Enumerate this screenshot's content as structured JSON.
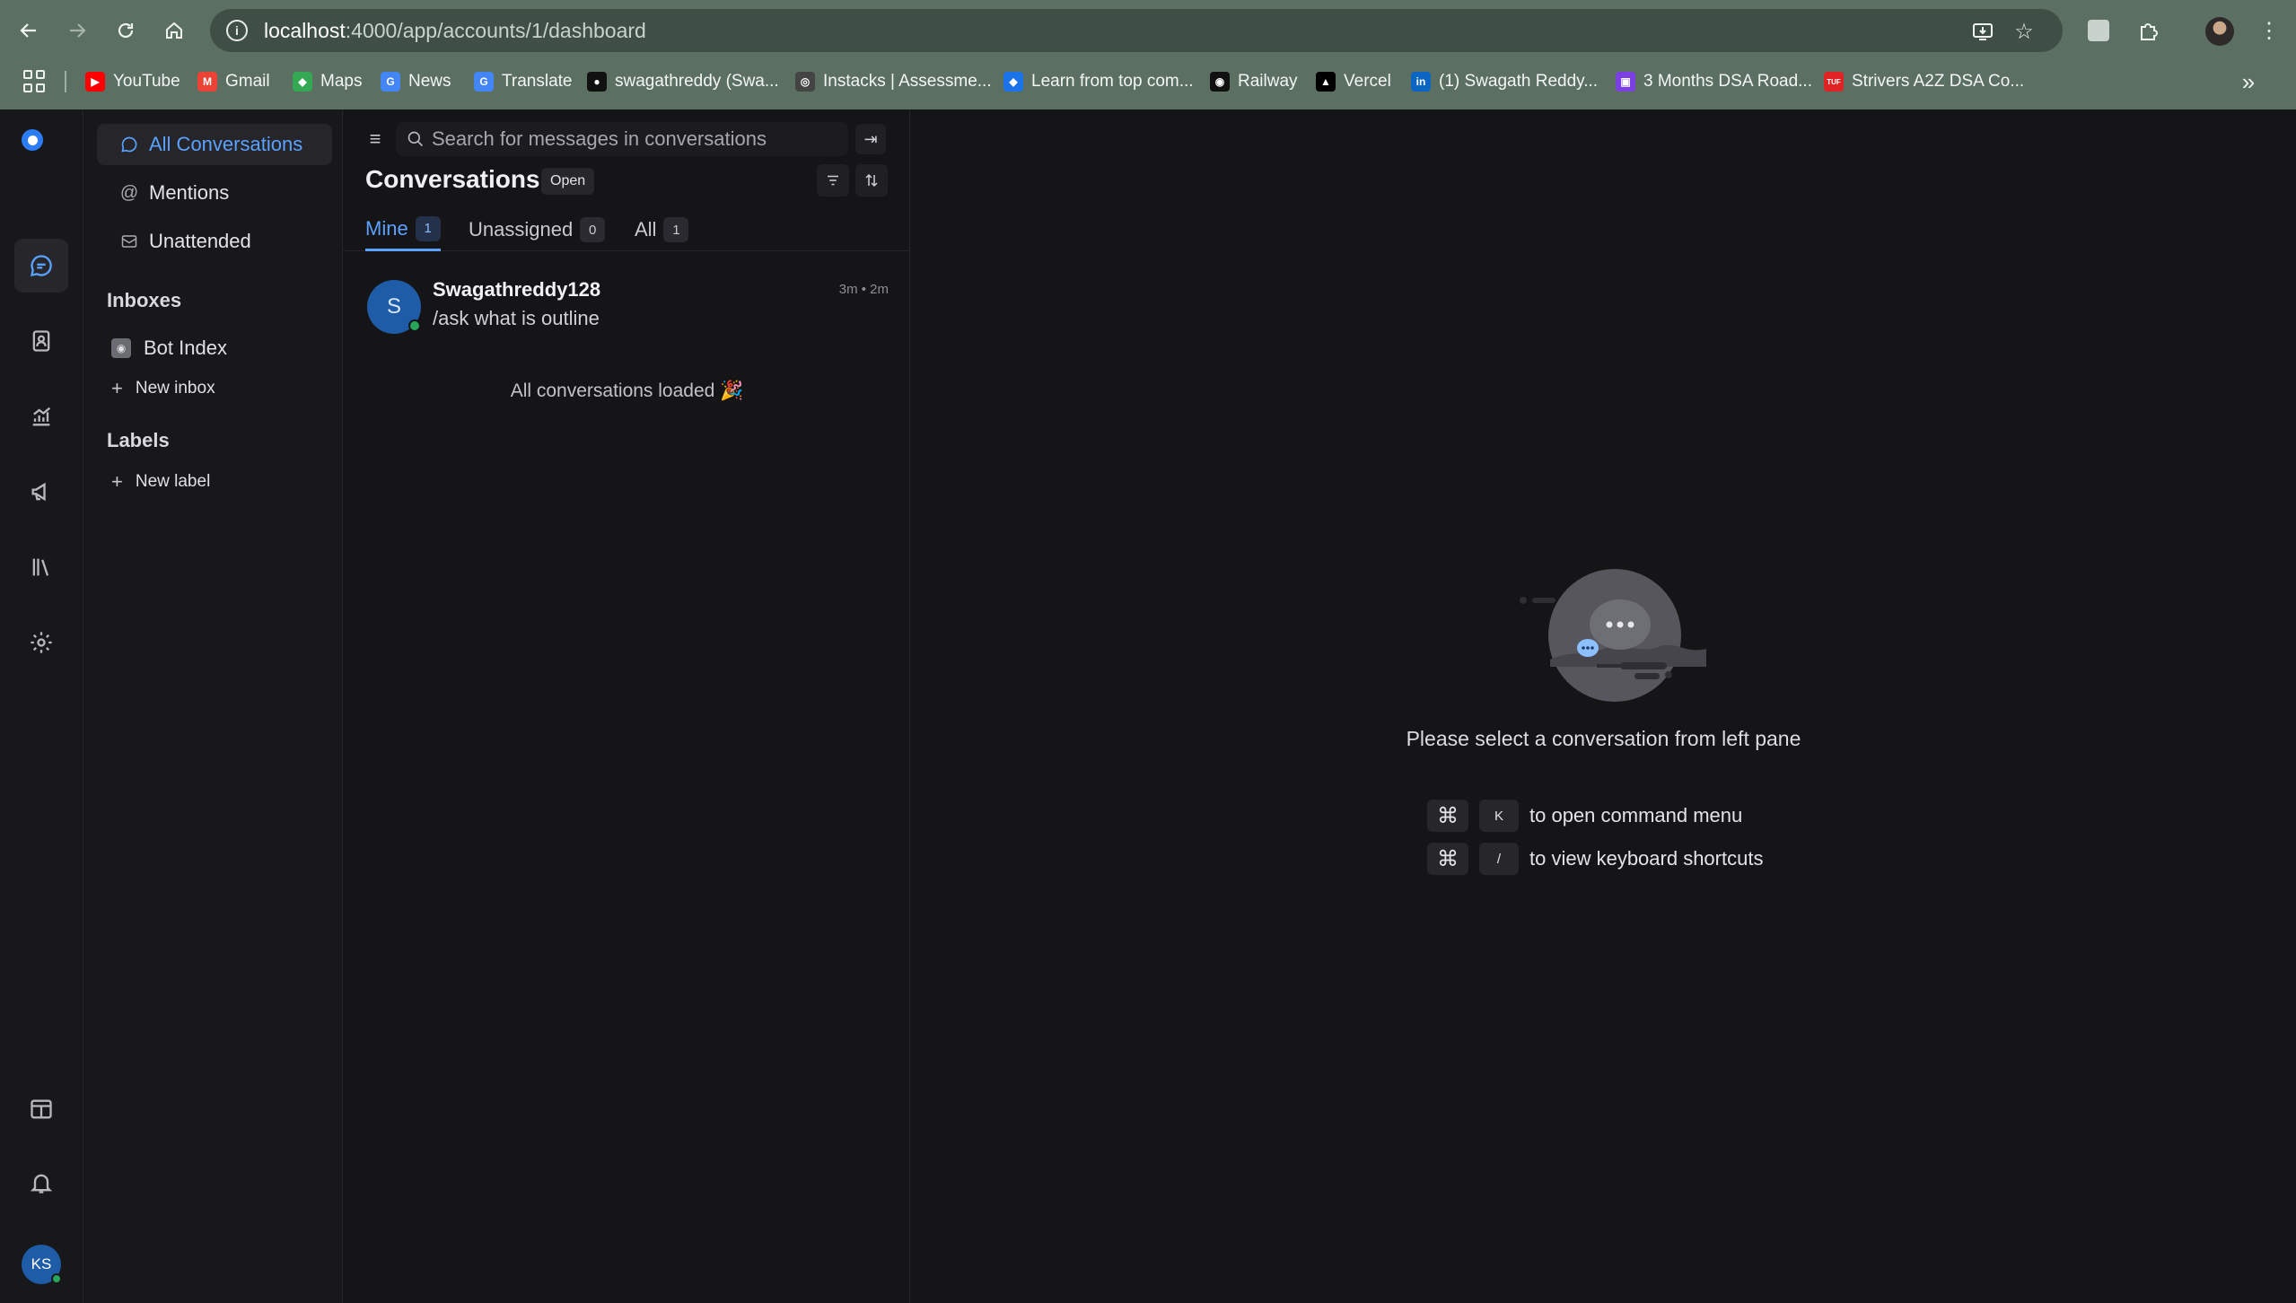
{
  "browser": {
    "url_host": "localhost",
    "url_rest": ":4000/app/accounts/1/dashboard",
    "bookmarks": [
      {
        "label": "YouTube",
        "favicon": "youtube-icon",
        "color": "#ff0000"
      },
      {
        "label": "Gmail",
        "favicon": "gmail-icon",
        "color": "#ea4335"
      },
      {
        "label": "Maps",
        "favicon": "maps-icon",
        "color": "#34a853"
      },
      {
        "label": "News",
        "favicon": "news-icon",
        "color": "#4285f4"
      },
      {
        "label": "Translate",
        "favicon": "translate-icon",
        "color": "#4285f4"
      },
      {
        "label": "swagathreddy (Swa...",
        "favicon": "github-icon",
        "color": "#111111"
      },
      {
        "label": "Instacks | Assessme...",
        "favicon": "instacks-icon",
        "color": "#444444"
      },
      {
        "label": "Learn from top com...",
        "favicon": "learn-icon",
        "color": "#1a73e8"
      },
      {
        "label": "Railway",
        "favicon": "railway-icon",
        "color": "#111111"
      },
      {
        "label": "Vercel",
        "favicon": "vercel-icon",
        "color": "#000000"
      },
      {
        "label": "(1) Swagath Reddy...",
        "favicon": "linkedin-icon",
        "color": "#0a66c2"
      },
      {
        "label": "3 Months DSA Road...",
        "favicon": "roadmap-icon",
        "color": "#7b3fe4"
      },
      {
        "label": "Strivers A2Z DSA Co...",
        "favicon": "tuf-icon",
        "color": "#e02424"
      }
    ]
  },
  "sidebar": {
    "items": [
      {
        "label": "All Conversations",
        "icon": "chat-icon"
      },
      {
        "label": "Mentions",
        "icon": "at-icon"
      },
      {
        "label": "Unattended",
        "icon": "mail-icon"
      }
    ],
    "inboxes_heading": "Inboxes",
    "inbox": "Bot Index",
    "new_inbox": "New inbox",
    "labels_heading": "Labels",
    "new_label": "New label"
  },
  "conversations": {
    "search_placeholder": "Search for messages in conversations",
    "title": "Conversations",
    "status": "Open",
    "tabs": [
      {
        "label": "Mine",
        "count": "1"
      },
      {
        "label": "Unassigned",
        "count": "0"
      },
      {
        "label": "All",
        "count": "1"
      }
    ],
    "list": [
      {
        "initial": "S",
        "name": "Swagathreddy128",
        "message": "/ask what is outline",
        "time": "3m • 2m"
      }
    ],
    "all_loaded": "All conversations loaded 🎉"
  },
  "main": {
    "empty_text": "Please select a conversation from left pane",
    "shortcuts": [
      {
        "mod": "⌘",
        "key": "K",
        "text": "to open command menu"
      },
      {
        "mod": "⌘",
        "key": "/",
        "text": "to view keyboard shortcuts"
      }
    ]
  },
  "user": {
    "initials": "KS"
  },
  "colors": {
    "accent": "#5aa2ff",
    "online": "#27a55a",
    "avatar": "#1e5ca8",
    "chrome": "#5b6f63"
  }
}
